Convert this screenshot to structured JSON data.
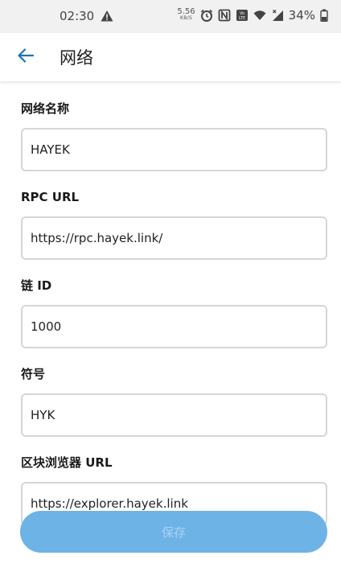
{
  "status_bar": {
    "time": "02:30",
    "net_speed_value": "5.56",
    "net_speed_unit": "KB/S",
    "battery": "34%"
  },
  "header": {
    "title": "网络"
  },
  "form": {
    "network_name_label": "网络名称",
    "network_name_value": "HAYEK",
    "rpc_url_label": "RPC URL",
    "rpc_url_value": "https://rpc.hayek.link/",
    "chain_id_label": "链 ID",
    "chain_id_value": "1000",
    "symbol_label": "符号",
    "symbol_value": "HYK",
    "explorer_label": "区块浏览器 URL",
    "explorer_value": "https://explorer.hayek.link"
  },
  "save_button_label": "保存",
  "colors": {
    "accent": "#1a73b8",
    "save_button_bg": "#6eb3e6",
    "input_border": "#d6d6d6"
  },
  "icons": {
    "back": "arrow-left-icon",
    "warning": "warning-icon",
    "alarm": "alarm-icon",
    "nfc": "nfc-icon",
    "volte": "volte-icon",
    "wifi": "wifi-icon",
    "signal": "signal-icon",
    "battery": "battery-icon"
  }
}
